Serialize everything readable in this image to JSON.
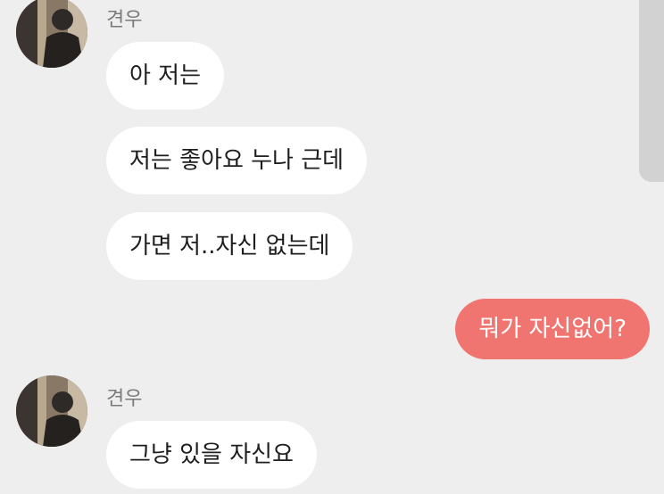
{
  "messages": [
    {
      "type": "incoming",
      "sender": "견우",
      "text": "아 저는"
    },
    {
      "type": "incoming",
      "text": "저는 좋아요 누나 근데"
    },
    {
      "type": "incoming",
      "text": "가면 저..자신 없는데"
    },
    {
      "type": "outgoing",
      "text": "뭐가 자신없어?"
    },
    {
      "type": "incoming",
      "sender": "견우",
      "text": "그냥 있을 자신요"
    }
  ],
  "colors": {
    "background": "#eeeeee",
    "incoming_bubble": "#ffffff",
    "outgoing_bubble": "#f07470",
    "sender_name": "#7a7a7a"
  }
}
